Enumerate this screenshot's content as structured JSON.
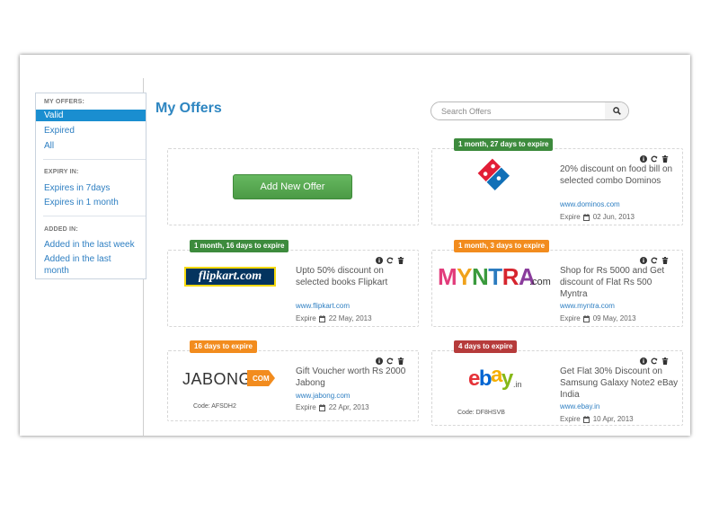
{
  "page_title": "My Offers",
  "search": {
    "placeholder": "Search Offers",
    "icon": "search-icon"
  },
  "sidebar": {
    "sections": [
      {
        "heading": "MY OFFERS:",
        "items": [
          "Valid",
          "Expired",
          "All"
        ],
        "active": "Valid"
      },
      {
        "heading": "EXPIRY IN:",
        "items": [
          "Expires in 7days",
          "Expires in 1 month"
        ]
      },
      {
        "heading": "ADDED IN:",
        "items": [
          "Added in the last week",
          "Added in the last month"
        ]
      }
    ]
  },
  "add_offer": {
    "label": "Add New Offer"
  },
  "expire_label": "Expire",
  "offers": [
    {
      "badge": "1 month, 27 days to expire",
      "badge_color": "#3d8b3d",
      "brand": "Domino's Pizza",
      "description": "20% discount on food bill on selected combo Dominos",
      "url": "www.dominos.com",
      "expire_date": "02 Jun, 2013",
      "code": ""
    },
    {
      "badge": "1 month, 16 days to expire",
      "badge_color": "#3d8b3d",
      "brand": "flipkart.com",
      "description": "Upto 50% discount on selected books Flipkart",
      "url": "www.flipkart.com",
      "expire_date": "22 May, 2013",
      "code": ""
    },
    {
      "badge": "1 month, 3 days to expire",
      "badge_color": "#f28c1e",
      "brand": "MYNTRA.com",
      "description": "Shop for Rs 5000 and Get discount of Flat Rs 500 Myntra",
      "url": "www.myntra.com",
      "expire_date": "09 May, 2013",
      "code": ""
    },
    {
      "badge": "16 days to expire",
      "badge_color": "#f28c1e",
      "brand": "JABONG.COM",
      "description": "Gift Voucher worth Rs 2000 Jabong",
      "url": "www.jabong.com",
      "expire_date": "22 Apr, 2013",
      "code": "Code: AFSDH2"
    },
    {
      "badge": "4 days to expire",
      "badge_color": "#b63b3b",
      "brand": "ebay.in",
      "description": "Get Flat 30% Discount on Samsung Galaxy Note2 eBay India",
      "url": "www.ebay.in",
      "expire_date": "10 Apr, 2013",
      "code": "Code: DF8HSVB"
    }
  ]
}
